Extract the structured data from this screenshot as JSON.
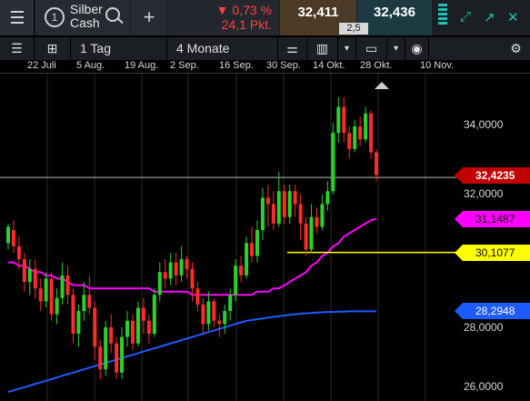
{
  "header": {
    "menu_icon": "hamburger-menu-icon",
    "instrument_number": "1",
    "instrument_name_line1": "Silber",
    "instrument_name_line2": "Cash",
    "change_percent": "▼ 0,73 %",
    "change_points": "24,1 Pkt.",
    "bid": "32,411",
    "ask": "32,436",
    "spread": "2,5",
    "colors": {
      "down": "#ff4040",
      "bid_bg": "#4a3a26",
      "ask_bg": "#1d3a42",
      "accent": "#19c3b5"
    }
  },
  "toolbar": {
    "interval": "1 Tag",
    "range": "4 Monate"
  },
  "chart_data": {
    "type": "candlestick",
    "x_ticks": [
      "22 Juli",
      "5 Aug.",
      "19 Aug.",
      "2 Sep.",
      "16 Sep.",
      "30 Sep.",
      "14 Okt.",
      "28 Okt.",
      "10 Nov."
    ],
    "y_ticks": [
      26,
      28,
      32,
      34
    ],
    "y_tick_labels": [
      "26,0000",
      "28,0000",
      "32,0000",
      "34,0000"
    ],
    "ylim": [
      25.8,
      35.8
    ],
    "price_labels": [
      {
        "value": 32.4235,
        "label": "32,4235",
        "color": "#c00000",
        "text_color": "#ffffff"
      },
      {
        "value": 31.1487,
        "label": "31,1487",
        "color": "#ff00ff",
        "text_color": "#000000"
      },
      {
        "value": 30.1077,
        "label": "30,1077",
        "color": "#ffff00",
        "text_color": "#000000"
      },
      {
        "value": 28.2948,
        "label": "28,2948",
        "color": "#1d5bff",
        "text_color": "#ffffff"
      }
    ],
    "horizontal_lines": [
      {
        "value": 32.4235,
        "color": "#bbbbbb",
        "from": "left"
      },
      {
        "value": 30.1077,
        "color": "#ffff00",
        "from": "x:316"
      }
    ],
    "candles": [
      [
        30.4,
        30.9,
        30.2,
        31.0
      ],
      [
        30.8,
        30.3,
        30.1,
        31.1
      ],
      [
        30.3,
        29.9,
        29.6,
        30.6
      ],
      [
        29.9,
        29.2,
        28.9,
        30.1
      ],
      [
        29.2,
        29.6,
        28.8,
        29.9
      ],
      [
        29.6,
        29.0,
        28.7,
        29.9
      ],
      [
        29.0,
        28.6,
        28.3,
        29.3
      ],
      [
        28.6,
        29.3,
        28.4,
        29.5
      ],
      [
        29.3,
        28.2,
        28.0,
        29.5
      ],
      [
        28.2,
        28.7,
        27.9,
        29.0
      ],
      [
        28.7,
        29.4,
        28.5,
        29.8
      ],
      [
        29.4,
        28.8,
        28.5,
        29.7
      ],
      [
        28.8,
        27.6,
        27.3,
        29.0
      ],
      [
        27.6,
        28.3,
        27.2,
        28.5
      ],
      [
        28.3,
        28.8,
        28.0,
        29.2
      ],
      [
        28.8,
        28.4,
        28.2,
        29.4
      ],
      [
        28.4,
        27.2,
        26.8,
        28.6
      ],
      [
        27.2,
        26.5,
        26.2,
        27.4
      ],
      [
        26.5,
        27.8,
        26.3,
        28.0
      ],
      [
        27.8,
        27.3,
        27.0,
        28.2
      ],
      [
        27.3,
        26.4,
        26.2,
        27.5
      ],
      [
        26.4,
        27.5,
        26.2,
        27.8
      ],
      [
        27.5,
        28.0,
        27.2,
        28.3
      ],
      [
        28.0,
        27.3,
        27.1,
        28.2
      ],
      [
        27.3,
        28.4,
        27.2,
        28.6
      ],
      [
        28.4,
        28.0,
        27.6,
        28.7
      ],
      [
        28.0,
        27.6,
        27.3,
        28.2
      ],
      [
        27.6,
        28.8,
        27.5,
        29.0
      ],
      [
        28.8,
        29.5,
        28.6,
        29.8
      ],
      [
        29.5,
        29.3,
        29.0,
        29.9
      ],
      [
        29.3,
        29.8,
        29.1,
        30.1
      ],
      [
        29.8,
        29.4,
        29.1,
        30.1
      ],
      [
        29.4,
        29.9,
        29.2,
        30.3
      ],
      [
        29.9,
        29.6,
        29.3,
        30.0
      ],
      [
        29.6,
        29.0,
        28.6,
        29.8
      ],
      [
        29.0,
        28.5,
        28.3,
        29.2
      ],
      [
        28.5,
        27.9,
        27.6,
        28.7
      ],
      [
        27.9,
        28.6,
        27.7,
        28.9
      ],
      [
        28.6,
        28.0,
        27.8,
        28.7
      ],
      [
        28.0,
        27.9,
        27.5,
        28.2
      ],
      [
        27.9,
        28.3,
        27.6,
        28.5
      ],
      [
        28.3,
        28.8,
        28.0,
        29.0
      ],
      [
        28.8,
        29.7,
        28.6,
        29.9
      ],
      [
        29.7,
        29.4,
        29.2,
        30.0
      ],
      [
        29.4,
        30.4,
        29.3,
        30.6
      ],
      [
        30.4,
        30.0,
        29.8,
        30.9
      ],
      [
        30.0,
        30.8,
        29.8,
        31.1
      ],
      [
        30.8,
        31.8,
        30.5,
        32.1
      ],
      [
        31.8,
        31.6,
        30.9,
        32.2
      ],
      [
        31.6,
        31.0,
        30.8,
        32.0
      ],
      [
        31.0,
        32.0,
        30.9,
        32.6
      ],
      [
        32.0,
        31.2,
        31.0,
        32.2
      ],
      [
        31.2,
        32.0,
        31.0,
        32.2
      ],
      [
        32.0,
        31.6,
        31.2,
        32.2
      ],
      [
        31.6,
        31.0,
        30.5,
        31.9
      ],
      [
        31.0,
        30.2,
        30.0,
        31.2
      ],
      [
        30.2,
        31.2,
        30.1,
        31.6
      ],
      [
        31.2,
        30.9,
        30.7,
        31.5
      ],
      [
        30.9,
        31.6,
        30.8,
        31.9
      ],
      [
        31.6,
        32.0,
        31.4,
        32.3
      ],
      [
        32.0,
        33.8,
        31.9,
        34.1
      ],
      [
        33.8,
        34.6,
        33.5,
        34.9
      ],
      [
        34.6,
        33.8,
        33.5,
        34.9
      ],
      [
        33.8,
        33.3,
        33.0,
        34.0
      ],
      [
        33.3,
        34.0,
        33.2,
        34.2
      ],
      [
        34.0,
        33.6,
        33.4,
        34.3
      ],
      [
        33.6,
        34.4,
        33.5,
        34.6
      ],
      [
        34.4,
        33.2,
        33.0,
        34.5
      ],
      [
        33.2,
        32.5,
        32.3,
        33.3
      ]
    ],
    "moving_averages": [
      {
        "name": "",
        "color": "#ff00ff",
        "values": [
          29.8,
          29.8,
          29.7,
          29.7,
          29.6,
          29.5,
          29.5,
          29.4,
          29.4,
          29.3,
          29.3,
          29.2,
          29.1,
          29.1,
          29.1,
          29.0,
          29.0,
          29.0,
          29.0,
          29.0,
          29.0,
          29.0,
          29.0,
          29.0,
          29.0,
          29.0,
          29.0,
          28.9,
          28.9,
          28.9,
          28.9,
          28.9,
          28.9,
          28.9,
          28.8,
          28.8,
          28.8,
          28.8,
          28.8,
          28.8,
          28.8,
          28.8,
          28.8,
          28.8,
          28.8,
          28.8,
          28.9,
          28.9,
          28.9,
          29.0,
          29.0,
          29.1,
          29.2,
          29.3,
          29.4,
          29.5,
          29.7,
          29.8,
          30.0,
          30.1,
          30.3,
          30.4,
          30.6,
          30.7,
          30.8,
          30.9,
          31.0,
          31.1,
          31.15
        ]
      },
      {
        "name": "",
        "color": "#1d5bff",
        "values": [
          25.8,
          25.85,
          25.9,
          25.95,
          26.0,
          26.05,
          26.1,
          26.15,
          26.2,
          26.25,
          26.3,
          26.35,
          26.4,
          26.45,
          26.5,
          26.55,
          26.6,
          26.65,
          26.7,
          26.75,
          26.8,
          26.85,
          26.9,
          26.95,
          27.0,
          27.05,
          27.1,
          27.15,
          27.2,
          27.25,
          27.3,
          27.35,
          27.4,
          27.45,
          27.5,
          27.55,
          27.6,
          27.65,
          27.7,
          27.75,
          27.8,
          27.85,
          27.9,
          27.95,
          28.0,
          28.02,
          28.05,
          28.07,
          28.1,
          28.12,
          28.14,
          28.16,
          28.18,
          28.2,
          28.22,
          28.23,
          28.24,
          28.25,
          28.26,
          28.27,
          28.27,
          28.28,
          28.28,
          28.29,
          28.29,
          28.29,
          28.29,
          28.29,
          28.29
        ]
      }
    ],
    "grid": true,
    "candle_colors": {
      "up": "#2bd12b",
      "down": "#ff2a2a"
    }
  }
}
